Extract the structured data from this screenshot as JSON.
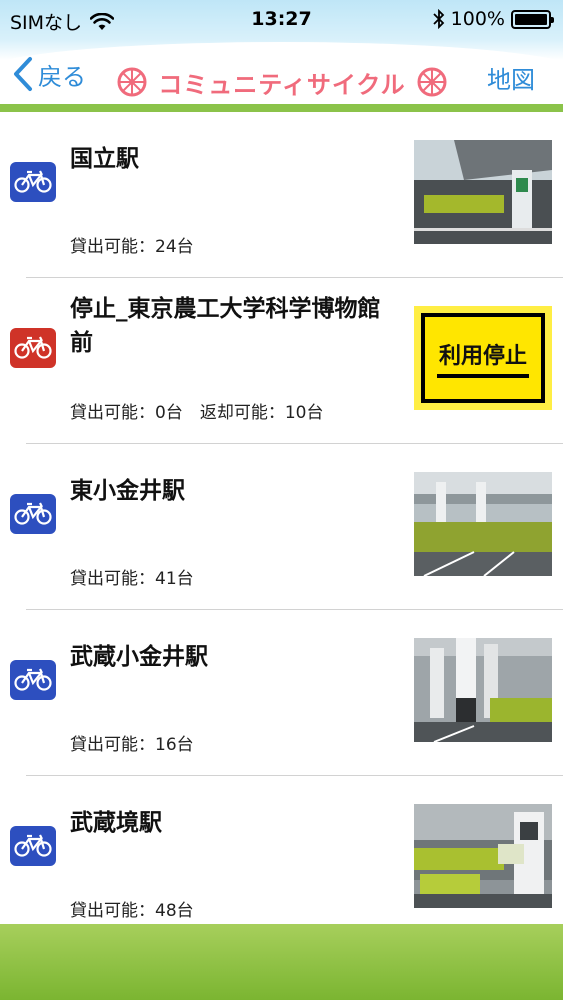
{
  "status_bar": {
    "carrier": "SIMなし",
    "time": "13:27",
    "battery": "100%"
  },
  "nav": {
    "back_label": "戻る",
    "title": "コミュニティサイクル",
    "map_label": "地図"
  },
  "colors": {
    "link": "#2f8cd8",
    "title": "#f06b7c",
    "bike_available": "#2d4fbf",
    "bike_stopped": "#cf3328",
    "bottom_bar": "#8bc34a"
  },
  "stations": [
    {
      "name": "国立駅",
      "status_icon": "bicycle-icon-blue",
      "info": "貸出可能：24台",
      "thumbnail": "station-photo-kunitachi"
    },
    {
      "name": "停止_東京農工大学科学博物館前",
      "status_icon": "bicycle-icon-red",
      "info": "貸出可能：0台　返却可能：10台",
      "thumbnail_text": "利用停止"
    },
    {
      "name": "東小金井駅",
      "status_icon": "bicycle-icon-blue",
      "info": "貸出可能：41台",
      "thumbnail": "station-photo-higashikoganei"
    },
    {
      "name": "武蔵小金井駅",
      "status_icon": "bicycle-icon-blue",
      "info": "貸出可能：16台",
      "thumbnail": "station-photo-musashikoganei"
    },
    {
      "name": "武蔵境駅",
      "status_icon": "bicycle-icon-blue",
      "info": "貸出可能：48台",
      "thumbnail": "station-photo-musashisakai"
    }
  ]
}
